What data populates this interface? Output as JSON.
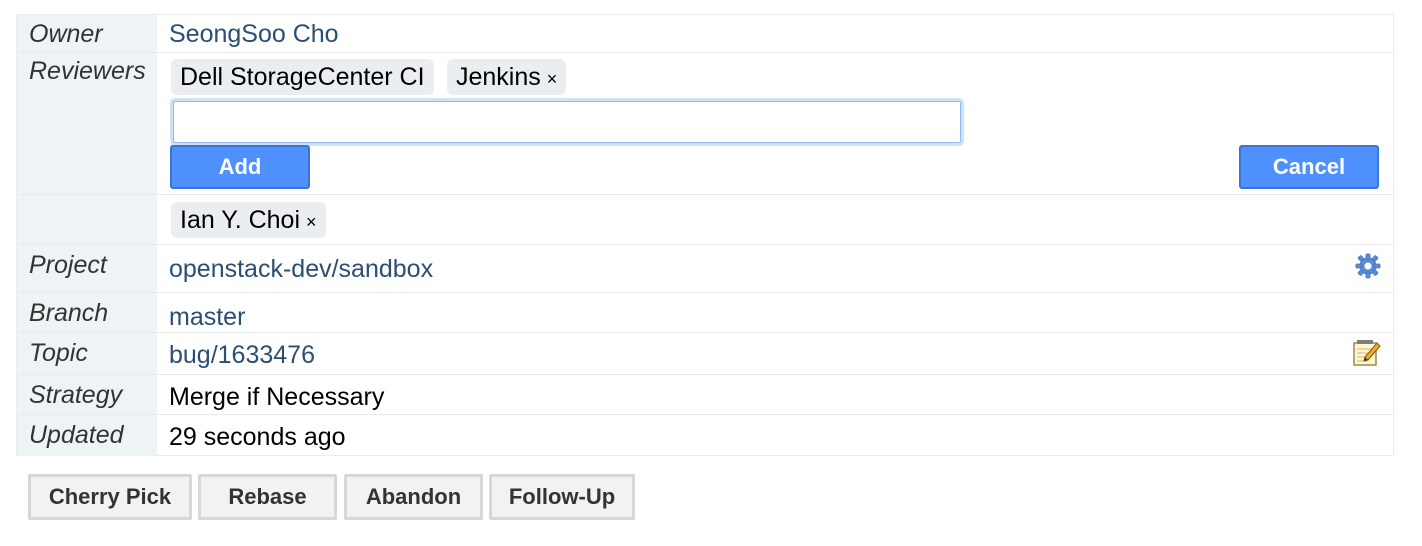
{
  "owner": {
    "label": "Owner",
    "value": "SeongSoo Cho"
  },
  "reviewers": {
    "label": "Reviewers",
    "chips": [
      "Dell StorageCenter CI",
      "Jenkins"
    ],
    "remove_symbol": "×",
    "input_value": "",
    "add_label": "Add",
    "cancel_label": "Cancel",
    "cc_chip": "Ian Y. Choi"
  },
  "project": {
    "label": "Project",
    "value": "openstack-dev/sandbox",
    "icon": "gear-icon"
  },
  "branch": {
    "label": "Branch",
    "value": "master"
  },
  "topic": {
    "label": "Topic",
    "value": "bug/1633476",
    "icon": "edit-icon"
  },
  "strategy": {
    "label": "Strategy",
    "value": "Merge if Necessary"
  },
  "updated": {
    "label": "Updated",
    "value": "29 seconds ago"
  },
  "actions": {
    "cherry_pick": "Cherry Pick",
    "rebase": "Rebase",
    "abandon": "Abandon",
    "follow_up": "Follow-Up"
  },
  "colors": {
    "label_bg": "#eef3f5",
    "link": "#2b4e73",
    "primary_button": "#4d90fe",
    "chip_bg": "#ebeef0"
  }
}
